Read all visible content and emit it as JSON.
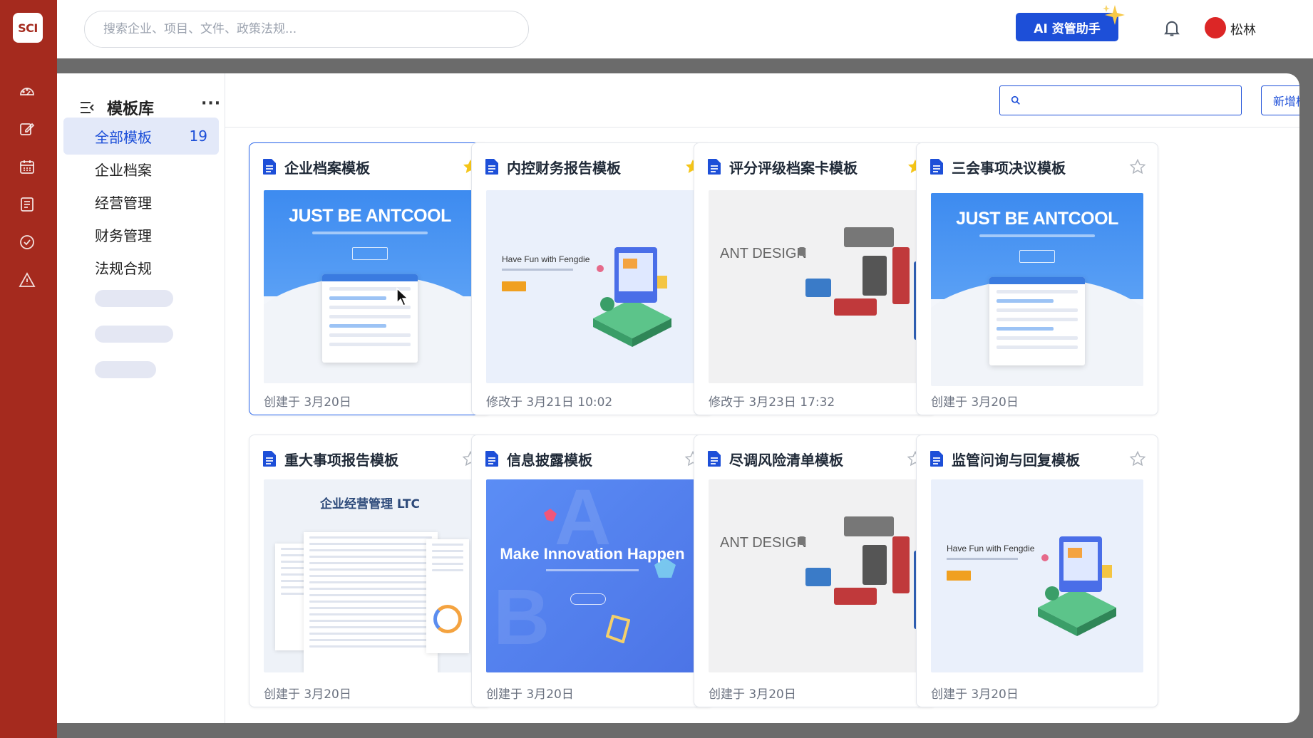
{
  "app": {
    "logo_text": "SCI"
  },
  "rail": {
    "items": [
      "dashboard-icon",
      "edit-icon",
      "calendar-icon",
      "list-icon",
      "check-circle-icon",
      "warning-icon"
    ]
  },
  "header": {
    "search_placeholder": "搜索企业、项目、文件、政策法规...",
    "ai_button": "AI 资管助手",
    "user_name": "松林"
  },
  "library": {
    "title": "模板库",
    "more": "···",
    "items": [
      {
        "label": "全部模板",
        "count": "19",
        "active": true
      },
      {
        "label": "企业档案"
      },
      {
        "label": "经营管理"
      },
      {
        "label": "财务管理"
      },
      {
        "label": "法规合规"
      }
    ]
  },
  "toolbar": {
    "search_placeholder": "",
    "add_label": "新增模板"
  },
  "templates": [
    {
      "title": "企业档案模板",
      "starred": true,
      "meta": "创建于 3月20日",
      "thumb": "antcool",
      "thumb_text": "JUST BE ANTCOOL",
      "selected": true
    },
    {
      "title": "内控财务报告模板",
      "starred": true,
      "meta": "修改于 3月21日 10:02",
      "thumb": "fengdie",
      "thumb_text": "Have Fun with Fengdie"
    },
    {
      "title": "评分评级档案卡模板",
      "starred": true,
      "meta": "修改于 3月23日 17:32",
      "thumb": "antdesign",
      "thumb_text": "ANT DESIGN"
    },
    {
      "title": "三会事项决议模板",
      "starred": false,
      "meta": "创建于 3月20日",
      "thumb": "antcool",
      "thumb_text": "JUST BE ANTCOOL"
    },
    {
      "title": "重大事项报告模板",
      "starred": false,
      "meta": "创建于 3月20日",
      "thumb": "ltc",
      "thumb_text": "企业经营管理 LTC"
    },
    {
      "title": "信息披露模板",
      "starred": false,
      "meta": "创建于 3月20日",
      "thumb": "innovation",
      "thumb_text": "Make Innovation Happen"
    },
    {
      "title": "尽调风险清单模板",
      "starred": false,
      "meta": "创建于 3月20日",
      "thumb": "antdesign",
      "thumb_text": "ANT DESIGN"
    },
    {
      "title": "监管问询与回复模板",
      "starred": false,
      "meta": "创建于 3月20日",
      "thumb": "fengdie",
      "thumb_text": "Have Fun with Fengdie"
    }
  ],
  "colors": {
    "rail": "#a52a1e",
    "accent": "#1d4fd8",
    "star": "#f5c518",
    "avatar": "#dc2626"
  }
}
